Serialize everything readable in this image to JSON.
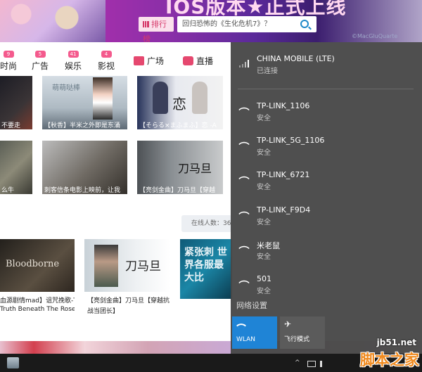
{
  "banner": {
    "title": "IOS版本★正式上线",
    "rank_label": "排行榜",
    "search_placeholder": "回归恐怖的《生化危机7》？",
    "watermark": "©MacGluQuarte"
  },
  "nav": {
    "items": [
      {
        "label": "时尚",
        "count": "9"
      },
      {
        "label": "广告",
        "count": "5"
      },
      {
        "label": "娱乐",
        "count": "41"
      },
      {
        "label": "影视",
        "count": "4"
      }
    ],
    "plaza": "广场",
    "live": "直播"
  },
  "videos": {
    "row1": [
      "不要走",
      "【秋香】半米之外即是东涌",
      "【そらる×まふまふ】恋 -A"
    ],
    "row2": [
      "么牛",
      "刺客信条电影上映前，让我",
      "【亮剑金曲】刀马旦【穿越"
    ],
    "row3": [
      {
        "title": "血源剧情mad】诅咒挽歌-T",
        "sub": "Truth Beneath The Rose",
        "thumb_text": "Bloodborne"
      },
      {
        "title": "【亮剑金曲】刀马旦【穿越抗",
        "sub": "战当团长】",
        "thumb_text": "刀马旦"
      },
      {
        "title": "",
        "sub": "",
        "thumb_text": "紧张刺 世界各服最 大比"
      }
    ],
    "thumb_texts": {
      "r1c1": "萌萌哒棒",
      "r1c2_logo": "恋",
      "r2c3": "刀马旦"
    }
  },
  "online_label": "在线人数：36",
  "network": {
    "connected": {
      "name": "CHINA MOBILE (LTE)",
      "status": "已连接"
    },
    "wifi": [
      {
        "name": "TP-LINK_1106",
        "status": "安全"
      },
      {
        "name": "TP-LINK_5G_1106",
        "status": "安全"
      },
      {
        "name": "TP-LINK_6721",
        "status": "安全"
      },
      {
        "name": "TP-LINK_F9D4",
        "status": "安全"
      },
      {
        "name": "米老鼠",
        "status": "安全"
      },
      {
        "name": "501",
        "status": "安全"
      }
    ],
    "settings_label": "网络设置",
    "tiles": [
      {
        "label": "WLAN",
        "icon": "wifi-icon",
        "active": true
      },
      {
        "label": "飞行模式",
        "icon": "airplane-icon",
        "active": false
      }
    ]
  },
  "taskbar": {
    "tray_arrow": "^"
  },
  "site_watermark": {
    "domain": "jb51.net",
    "name": "脚本之家"
  },
  "colors": {
    "accent": "#1f84d6",
    "flyout_bg": "#484848",
    "badge": "#f45a8d"
  }
}
